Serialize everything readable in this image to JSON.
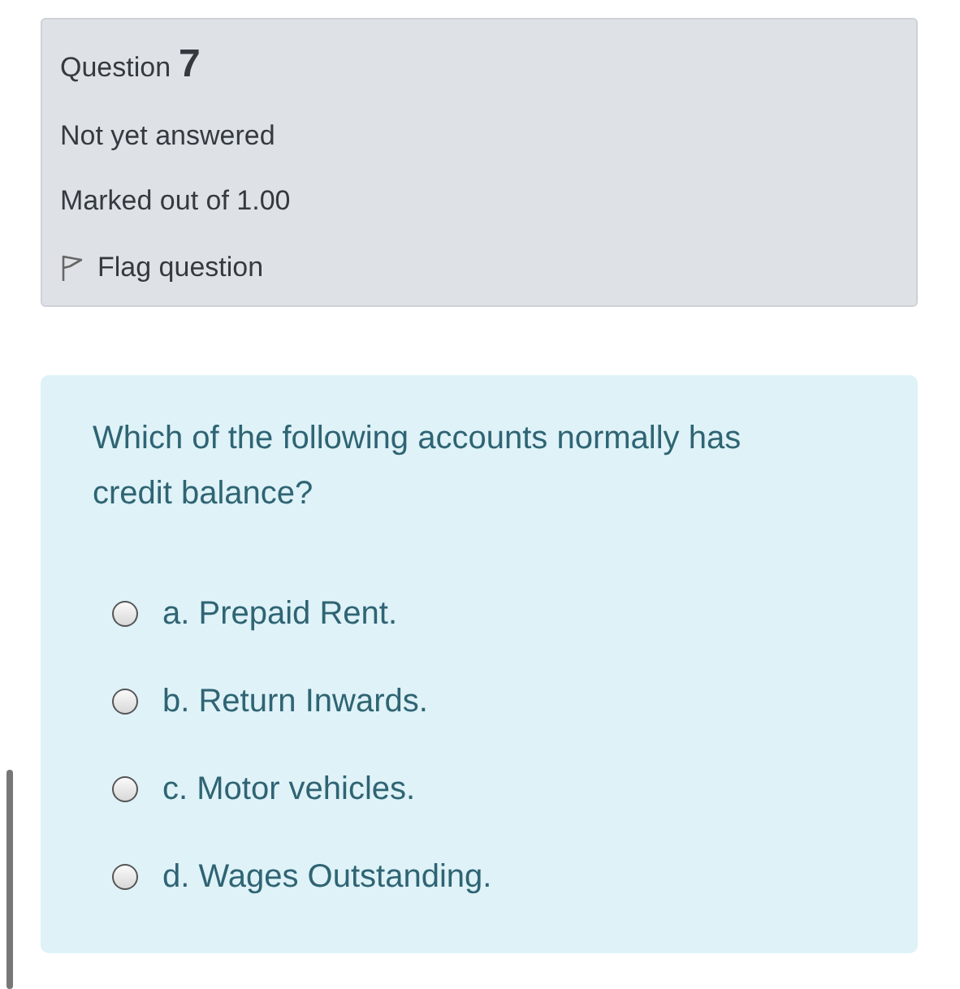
{
  "info": {
    "question_label": "Question",
    "question_number": "7",
    "status": "Not yet answered",
    "mark": "Marked out of 1.00",
    "flag": {
      "label": "Flag question",
      "flagged": false
    }
  },
  "formulation": {
    "question": "Which of the following accounts normally has credit balance?",
    "options": [
      {
        "label": "a. Prepaid Rent.",
        "selected": false
      },
      {
        "label": "b. Return Inwards.",
        "selected": false
      },
      {
        "label": "c. Motor vehicles.",
        "selected": false
      },
      {
        "label": "d. Wages Outstanding.",
        "selected": false
      }
    ]
  }
}
